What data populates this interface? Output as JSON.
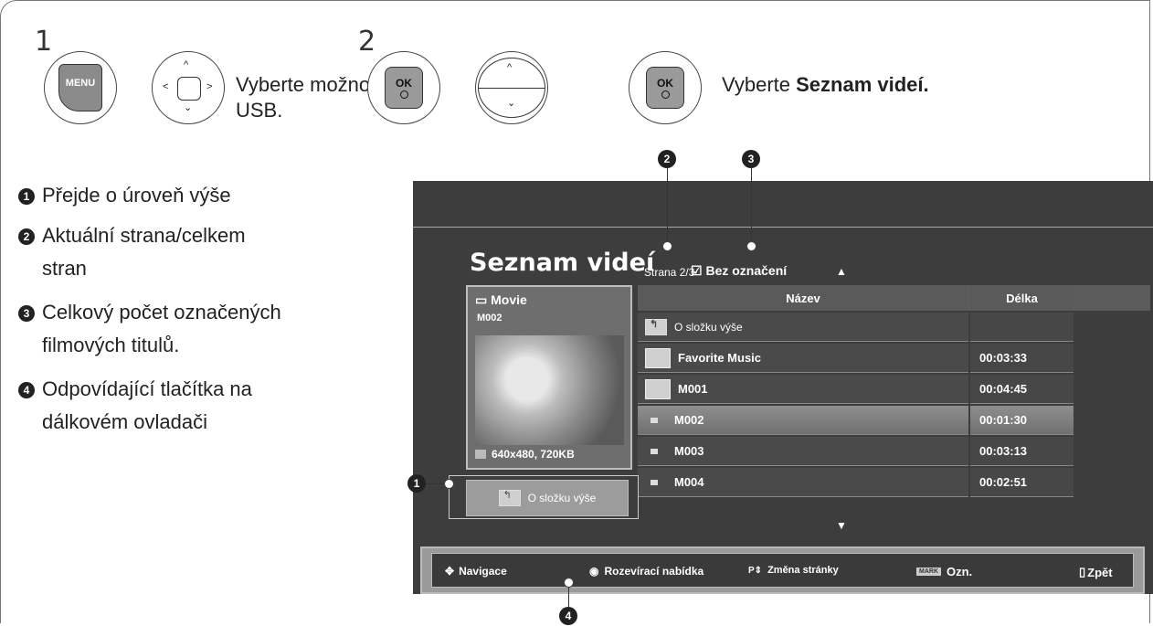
{
  "steps": {
    "step1_num": "1",
    "menu_label": "MENU",
    "step1_text_line1": "Vyberte možnost",
    "step1_text_line2": "USB.",
    "step2_num": "2",
    "ok_label": "OK",
    "step2_text_prefix": "Vyberte ",
    "step2_text_bold": "Seznam videí."
  },
  "legend": [
    {
      "num": "1",
      "line1": "Přejde o  úroveň výše",
      "line2": ""
    },
    {
      "num": "2",
      "line1": "Aktuální strana/celkem",
      "line2": "stran"
    },
    {
      "num": "3",
      "line1": "Celkový počet označených",
      "line2": "filmových titulů."
    },
    {
      "num": "4",
      "line1": "Odpovídající tlačítka na",
      "line2": "dálkovém ovladači"
    }
  ],
  "callouts": {
    "c1": "1",
    "c2": "2",
    "c3": "3",
    "c4": "4"
  },
  "screen": {
    "title": "Seznam videí",
    "page_info": "Strana 2/3",
    "marked": "Bez označení",
    "preview": {
      "folder": "Movie",
      "file": "M002",
      "info": "640x480, 720KB"
    },
    "up_button": "O složku výše",
    "table": {
      "col_name": "Název",
      "col_length": "Délka",
      "rows": [
        {
          "name": "O složku výše",
          "length": "",
          "type": "up"
        },
        {
          "name": "Favorite Music",
          "length": "00:03:33",
          "type": "folder"
        },
        {
          "name": "M001",
          "length": "00:04:45",
          "type": "folder"
        },
        {
          "name": "M002",
          "length": "00:01:30",
          "type": "file"
        },
        {
          "name": "M003",
          "length": "00:03:13",
          "type": "file"
        },
        {
          "name": "M004",
          "length": "00:02:51",
          "type": "file"
        }
      ]
    },
    "navbar": {
      "navigate": "Navigace",
      "popup": "Rozevírací nabídka",
      "page_change": "Změna stránky",
      "mark_key": "MARK",
      "mark": "Ozn.",
      "back": "Zpět"
    }
  }
}
